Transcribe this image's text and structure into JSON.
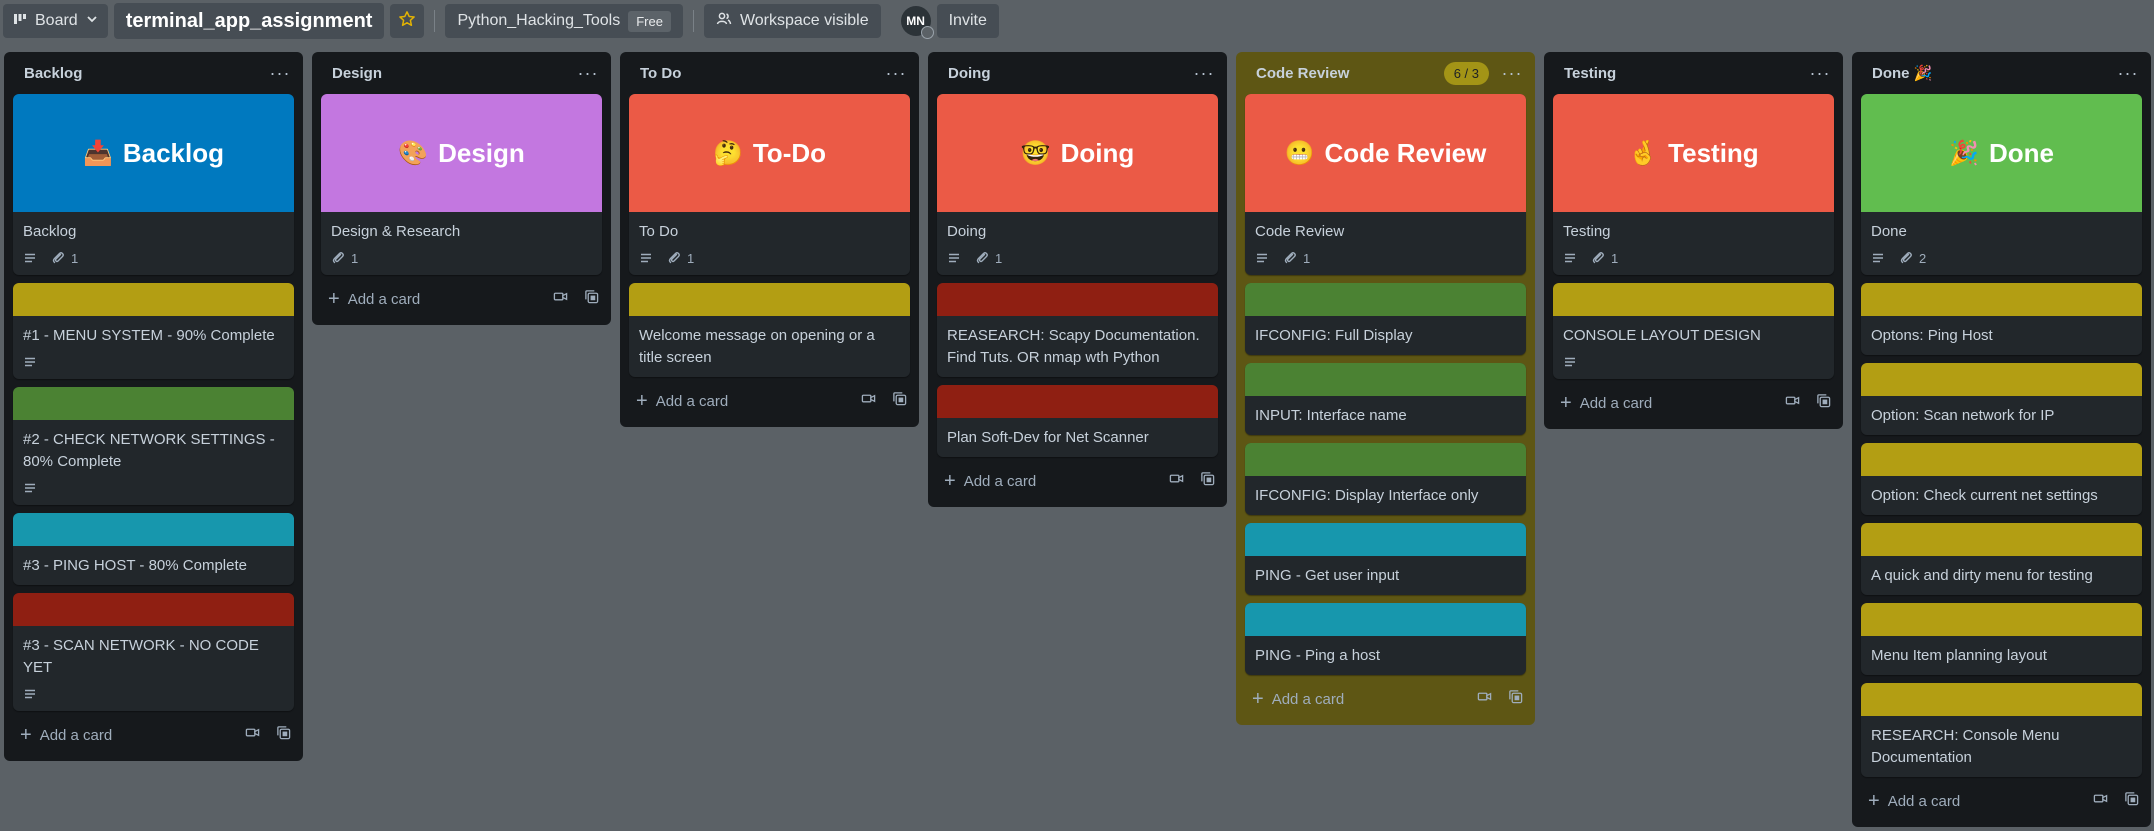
{
  "topbar": {
    "view_label": "Board",
    "board_title": "terminal_app_assignment",
    "workspace_name": "Python_Hacking_Tools",
    "plan_badge": "Free",
    "visibility_label": "Workspace visible",
    "avatar_initials": "MN",
    "invite_label": "Invite"
  },
  "colors": {
    "yellow": "#b39e13",
    "green": "#4b8233",
    "teal": "#1797ad",
    "red": "#8f1f12",
    "cover_blue": "#0079bf",
    "cover_purple": "#c377e0",
    "cover_orange": "#eb5a46",
    "cover_green": "#61bd4f"
  },
  "add_card_label": "Add a card",
  "lists": [
    {
      "title": "Backlog",
      "cards": [
        {
          "cover_text": "Backlog",
          "cover_emoji": "📥",
          "title": "Backlog",
          "desc": true,
          "attachments": "1"
        },
        {
          "title": "#1 - MENU SYSTEM - 90% Complete",
          "desc": true
        },
        {
          "title": "#2 - CHECK NETWORK SETTINGS - 80% Complete",
          "desc": true
        },
        {
          "title": "#3 - PING HOST - 80% Complete"
        },
        {
          "title": "#3 - SCAN NETWORK - NO CODE YET",
          "desc": true
        }
      ]
    },
    {
      "title": "Design",
      "cards": [
        {
          "cover_text": "Design",
          "cover_emoji": "🎨",
          "title": "Design & Research",
          "attachments": "1"
        }
      ]
    },
    {
      "title": "To Do",
      "cards": [
        {
          "cover_text": "To-Do",
          "cover_emoji": "🤔",
          "title": "To Do",
          "desc": true,
          "attachments": "1"
        },
        {
          "title": "Welcome message on opening or a title screen"
        }
      ]
    },
    {
      "title": "Doing",
      "cards": [
        {
          "cover_text": "Doing",
          "cover_emoji": "🤓",
          "title": "Doing",
          "desc": true,
          "attachments": "1"
        },
        {
          "title": "REASEARCH: Scapy Documentation. Find Tuts. OR nmap wth Python"
        },
        {
          "title": "Plan Soft-Dev for Net Scanner"
        }
      ]
    },
    {
      "title": "Code Review",
      "count": "6 / 3",
      "cards": [
        {
          "cover_text": "Code Review",
          "cover_emoji": "😬",
          "title": "Code Review",
          "desc": true,
          "attachments": "1"
        },
        {
          "title": "IFCONFIG: Full Display"
        },
        {
          "title": "INPUT: Interface name"
        },
        {
          "title": "IFCONFIG: Display Interface only"
        },
        {
          "title": "PING - Get user input"
        },
        {
          "title": "PING - Ping a host"
        }
      ]
    },
    {
      "title": "Testing",
      "cards": [
        {
          "cover_text": "Testing",
          "cover_emoji": "🤞",
          "title": "Testing",
          "desc": true,
          "attachments": "1"
        },
        {
          "title": "CONSOLE LAYOUT DESIGN",
          "desc": true
        }
      ]
    },
    {
      "title": "Done 🎉",
      "cards": [
        {
          "cover_text": "Done",
          "cover_emoji": "🎉",
          "title": "Done",
          "desc": true,
          "attachments": "2"
        },
        {
          "title": "Optons: Ping Host"
        },
        {
          "title": "Option: Scan network for IP"
        },
        {
          "title": "Option: Check current net settings"
        },
        {
          "title": "A quick and dirty menu for testing"
        },
        {
          "title": "Menu Item planning layout"
        },
        {
          "title": "RESEARCH: Console Menu Documentation"
        }
      ]
    }
  ]
}
